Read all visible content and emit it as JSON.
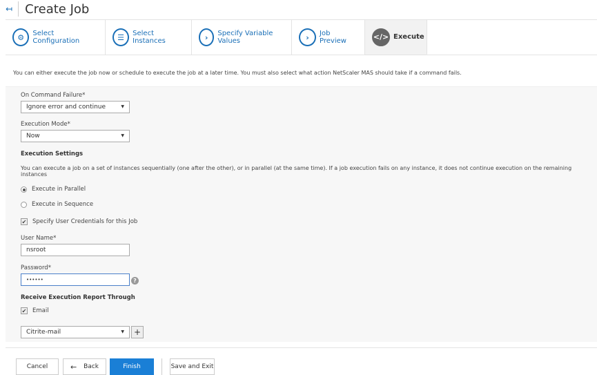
{
  "header": {
    "back_icon": "back-arrow-icon",
    "title": "Create Job"
  },
  "tabs": [
    {
      "label": "Select Configuration",
      "icon": "gear-icon"
    },
    {
      "label": "Select Instances",
      "icon": "server-icon"
    },
    {
      "label": "Specify Variable Values",
      "icon": "chevron-right-icon"
    },
    {
      "label": "Job Preview",
      "icon": "chevron-right-icon"
    },
    {
      "label": "Execute",
      "icon": "code-icon",
      "active": true
    }
  ],
  "intro": "You can either execute the job now or schedule to execute the job at a later time. You must also select what action NetScaler MAS should take if a command fails.",
  "form": {
    "failure_label": "On Command Failure*",
    "failure_value": "Ignore error and continue",
    "mode_label": "Execution Mode*",
    "mode_value": "Now",
    "settings_heading": "Execution Settings",
    "settings_desc": "You can execute a job on a set of instances sequentially (one after the other), or in parallel (at the same time). If a job execution fails on any instance, it does not continue execution on the remaining instances",
    "parallel": "Execute in Parallel",
    "sequence": "Execute in Sequence",
    "selected_mode": "Execute in Parallel",
    "credentials": "Specify User Credentials for this Job",
    "credentials_checked": true,
    "user_label": "User Name*",
    "user_value": "nsroot",
    "password_label": "Password*",
    "password_value": "••••••",
    "report_heading": "Receive Execution Report Through",
    "email": "Email",
    "email_checked": true,
    "mail_profile": "Citrite-mail"
  },
  "footer": {
    "cancel": "Cancel",
    "back": "Back",
    "finish": "Finish",
    "save_exit": "Save and Exit"
  },
  "colors": {
    "accent": "#1a7fd6",
    "link": "#1a6fb7"
  }
}
